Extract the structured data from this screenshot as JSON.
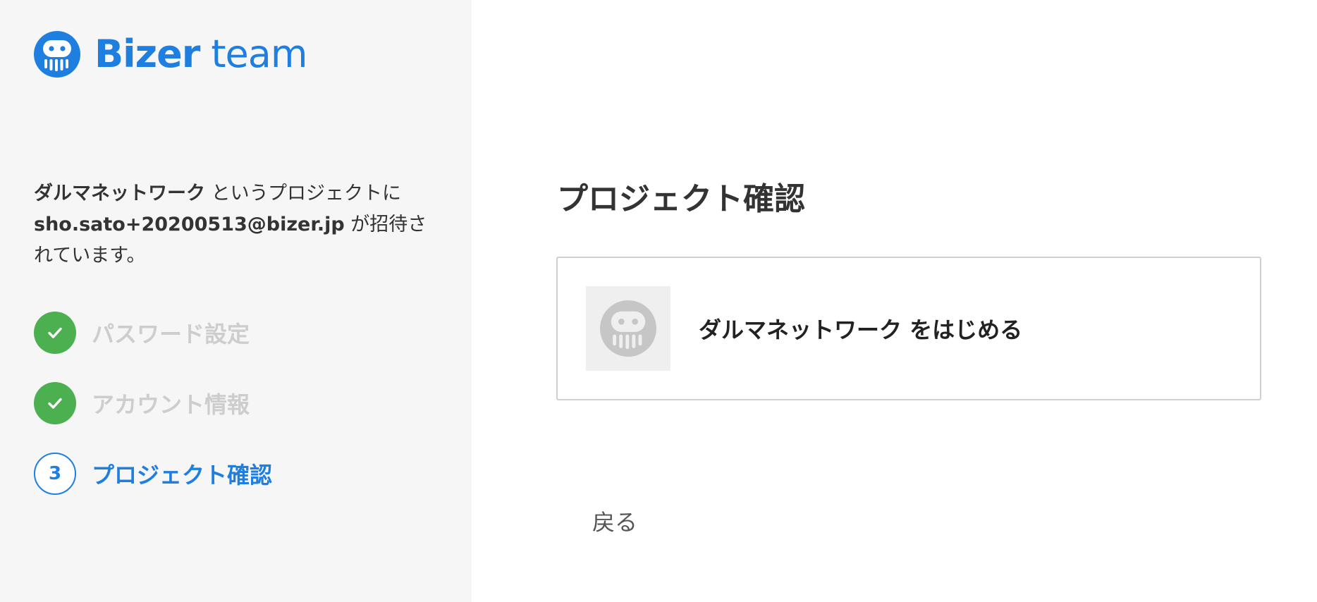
{
  "brand": {
    "name_bold": "Bizer",
    "name_light": "team",
    "logo_icon": "octopus-logo-icon",
    "accent_color": "#1e7fe0"
  },
  "invite": {
    "project_name": "ダルマネットワーク",
    "text_after_project": " というプロジェクトに",
    "email": "sho.sato+20200513@bizer.jp",
    "text_after_email": " が招待されています。"
  },
  "steps": [
    {
      "label": "パスワード設定",
      "status": "done",
      "icon": "check-icon"
    },
    {
      "label": "アカウント情報",
      "status": "done",
      "icon": "check-icon"
    },
    {
      "label": "プロジェクト確認",
      "status": "current",
      "number": "3"
    }
  ],
  "main": {
    "title": "プロジェクト確認",
    "project_card": {
      "label": "ダルマネットワーク をはじめる",
      "thumb_icon": "octopus-placeholder-icon"
    },
    "back_label": "戻る"
  },
  "colors": {
    "success": "#4caf50",
    "sidebar_bg": "#f6f6f6",
    "muted_text": "#cdcdcd"
  }
}
